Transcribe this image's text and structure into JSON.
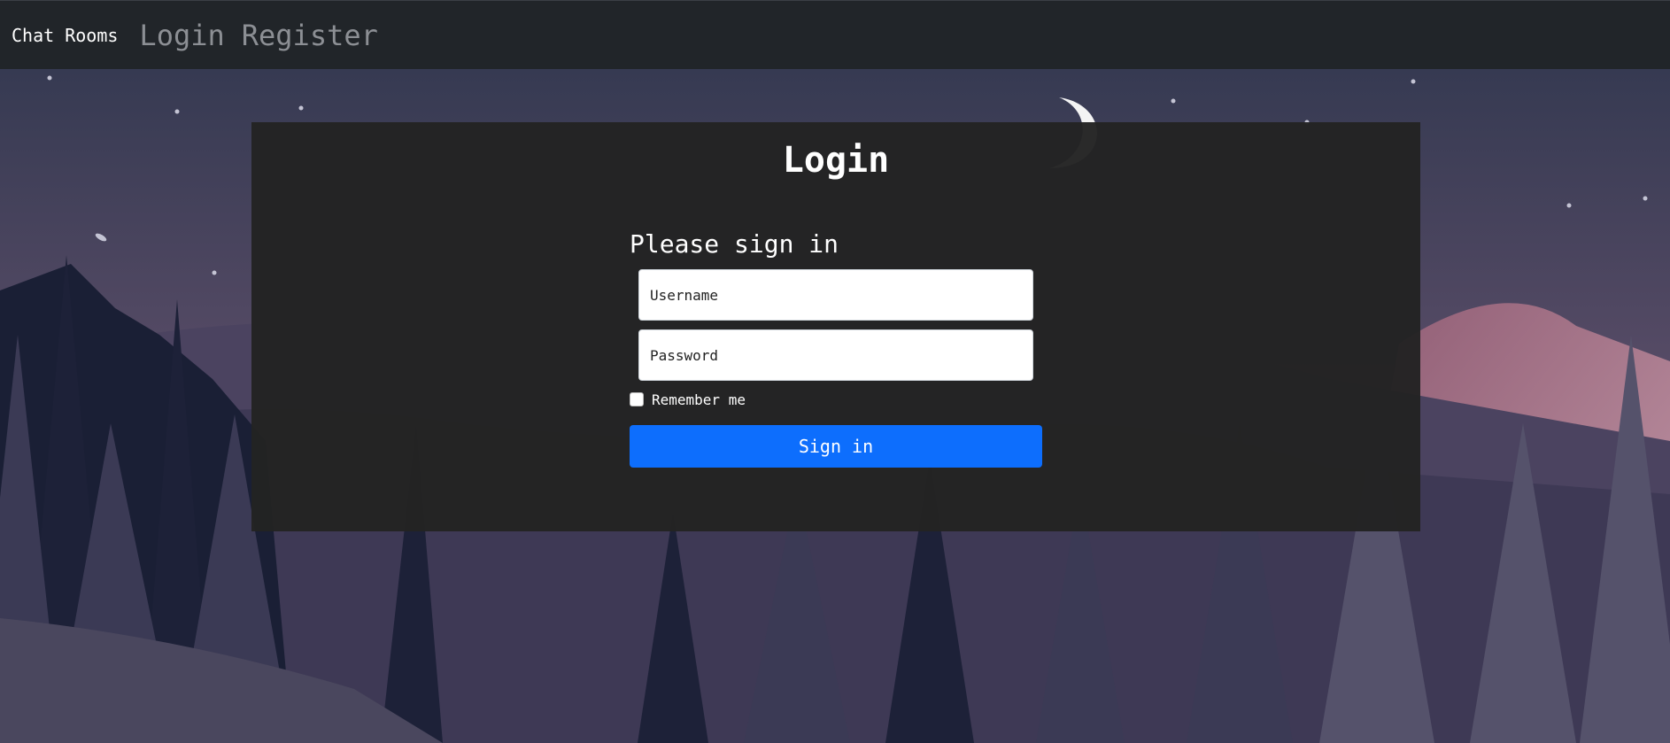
{
  "navbar": {
    "brand": "Chat Rooms",
    "links": [
      "Login",
      "Register"
    ]
  },
  "login": {
    "title": "Login",
    "heading": "Please sign in",
    "username_placeholder": "Username",
    "password_placeholder": "Password",
    "remember_label": "Remember me",
    "signin_label": "Sign in"
  },
  "colors": {
    "navbar_bg": "#212529",
    "panel_bg": "#232323",
    "primary_button": "#0d6efd"
  },
  "icons": [
    "moon-icon"
  ]
}
